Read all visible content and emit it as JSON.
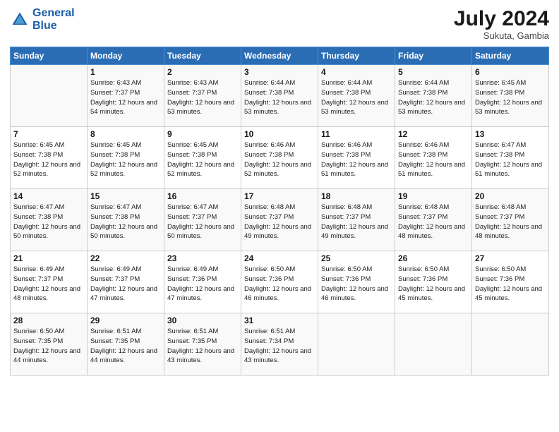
{
  "header": {
    "logo_line1": "General",
    "logo_line2": "Blue",
    "month_year": "July 2024",
    "location": "Sukuta, Gambia"
  },
  "days_of_week": [
    "Sunday",
    "Monday",
    "Tuesday",
    "Wednesday",
    "Thursday",
    "Friday",
    "Saturday"
  ],
  "weeks": [
    [
      {
        "num": "",
        "sunrise": "",
        "sunset": "",
        "daylight": ""
      },
      {
        "num": "1",
        "sunrise": "Sunrise: 6:43 AM",
        "sunset": "Sunset: 7:37 PM",
        "daylight": "Daylight: 12 hours and 54 minutes."
      },
      {
        "num": "2",
        "sunrise": "Sunrise: 6:43 AM",
        "sunset": "Sunset: 7:37 PM",
        "daylight": "Daylight: 12 hours and 53 minutes."
      },
      {
        "num": "3",
        "sunrise": "Sunrise: 6:44 AM",
        "sunset": "Sunset: 7:38 PM",
        "daylight": "Daylight: 12 hours and 53 minutes."
      },
      {
        "num": "4",
        "sunrise": "Sunrise: 6:44 AM",
        "sunset": "Sunset: 7:38 PM",
        "daylight": "Daylight: 12 hours and 53 minutes."
      },
      {
        "num": "5",
        "sunrise": "Sunrise: 6:44 AM",
        "sunset": "Sunset: 7:38 PM",
        "daylight": "Daylight: 12 hours and 53 minutes."
      },
      {
        "num": "6",
        "sunrise": "Sunrise: 6:45 AM",
        "sunset": "Sunset: 7:38 PM",
        "daylight": "Daylight: 12 hours and 53 minutes."
      }
    ],
    [
      {
        "num": "7",
        "sunrise": "Sunrise: 6:45 AM",
        "sunset": "Sunset: 7:38 PM",
        "daylight": "Daylight: 12 hours and 52 minutes."
      },
      {
        "num": "8",
        "sunrise": "Sunrise: 6:45 AM",
        "sunset": "Sunset: 7:38 PM",
        "daylight": "Daylight: 12 hours and 52 minutes."
      },
      {
        "num": "9",
        "sunrise": "Sunrise: 6:45 AM",
        "sunset": "Sunset: 7:38 PM",
        "daylight": "Daylight: 12 hours and 52 minutes."
      },
      {
        "num": "10",
        "sunrise": "Sunrise: 6:46 AM",
        "sunset": "Sunset: 7:38 PM",
        "daylight": "Daylight: 12 hours and 52 minutes."
      },
      {
        "num": "11",
        "sunrise": "Sunrise: 6:46 AM",
        "sunset": "Sunset: 7:38 PM",
        "daylight": "Daylight: 12 hours and 51 minutes."
      },
      {
        "num": "12",
        "sunrise": "Sunrise: 6:46 AM",
        "sunset": "Sunset: 7:38 PM",
        "daylight": "Daylight: 12 hours and 51 minutes."
      },
      {
        "num": "13",
        "sunrise": "Sunrise: 6:47 AM",
        "sunset": "Sunset: 7:38 PM",
        "daylight": "Daylight: 12 hours and 51 minutes."
      }
    ],
    [
      {
        "num": "14",
        "sunrise": "Sunrise: 6:47 AM",
        "sunset": "Sunset: 7:38 PM",
        "daylight": "Daylight: 12 hours and 50 minutes."
      },
      {
        "num": "15",
        "sunrise": "Sunrise: 6:47 AM",
        "sunset": "Sunset: 7:38 PM",
        "daylight": "Daylight: 12 hours and 50 minutes."
      },
      {
        "num": "16",
        "sunrise": "Sunrise: 6:47 AM",
        "sunset": "Sunset: 7:37 PM",
        "daylight": "Daylight: 12 hours and 50 minutes."
      },
      {
        "num": "17",
        "sunrise": "Sunrise: 6:48 AM",
        "sunset": "Sunset: 7:37 PM",
        "daylight": "Daylight: 12 hours and 49 minutes."
      },
      {
        "num": "18",
        "sunrise": "Sunrise: 6:48 AM",
        "sunset": "Sunset: 7:37 PM",
        "daylight": "Daylight: 12 hours and 49 minutes."
      },
      {
        "num": "19",
        "sunrise": "Sunrise: 6:48 AM",
        "sunset": "Sunset: 7:37 PM",
        "daylight": "Daylight: 12 hours and 48 minutes."
      },
      {
        "num": "20",
        "sunrise": "Sunrise: 6:48 AM",
        "sunset": "Sunset: 7:37 PM",
        "daylight": "Daylight: 12 hours and 48 minutes."
      }
    ],
    [
      {
        "num": "21",
        "sunrise": "Sunrise: 6:49 AM",
        "sunset": "Sunset: 7:37 PM",
        "daylight": "Daylight: 12 hours and 48 minutes."
      },
      {
        "num": "22",
        "sunrise": "Sunrise: 6:49 AM",
        "sunset": "Sunset: 7:37 PM",
        "daylight": "Daylight: 12 hours and 47 minutes."
      },
      {
        "num": "23",
        "sunrise": "Sunrise: 6:49 AM",
        "sunset": "Sunset: 7:36 PM",
        "daylight": "Daylight: 12 hours and 47 minutes."
      },
      {
        "num": "24",
        "sunrise": "Sunrise: 6:50 AM",
        "sunset": "Sunset: 7:36 PM",
        "daylight": "Daylight: 12 hours and 46 minutes."
      },
      {
        "num": "25",
        "sunrise": "Sunrise: 6:50 AM",
        "sunset": "Sunset: 7:36 PM",
        "daylight": "Daylight: 12 hours and 46 minutes."
      },
      {
        "num": "26",
        "sunrise": "Sunrise: 6:50 AM",
        "sunset": "Sunset: 7:36 PM",
        "daylight": "Daylight: 12 hours and 45 minutes."
      },
      {
        "num": "27",
        "sunrise": "Sunrise: 6:50 AM",
        "sunset": "Sunset: 7:36 PM",
        "daylight": "Daylight: 12 hours and 45 minutes."
      }
    ],
    [
      {
        "num": "28",
        "sunrise": "Sunrise: 6:50 AM",
        "sunset": "Sunset: 7:35 PM",
        "daylight": "Daylight: 12 hours and 44 minutes."
      },
      {
        "num": "29",
        "sunrise": "Sunrise: 6:51 AM",
        "sunset": "Sunset: 7:35 PM",
        "daylight": "Daylight: 12 hours and 44 minutes."
      },
      {
        "num": "30",
        "sunrise": "Sunrise: 6:51 AM",
        "sunset": "Sunset: 7:35 PM",
        "daylight": "Daylight: 12 hours and 43 minutes."
      },
      {
        "num": "31",
        "sunrise": "Sunrise: 6:51 AM",
        "sunset": "Sunset: 7:34 PM",
        "daylight": "Daylight: 12 hours and 43 minutes."
      },
      {
        "num": "",
        "sunrise": "",
        "sunset": "",
        "daylight": ""
      },
      {
        "num": "",
        "sunrise": "",
        "sunset": "",
        "daylight": ""
      },
      {
        "num": "",
        "sunrise": "",
        "sunset": "",
        "daylight": ""
      }
    ]
  ]
}
